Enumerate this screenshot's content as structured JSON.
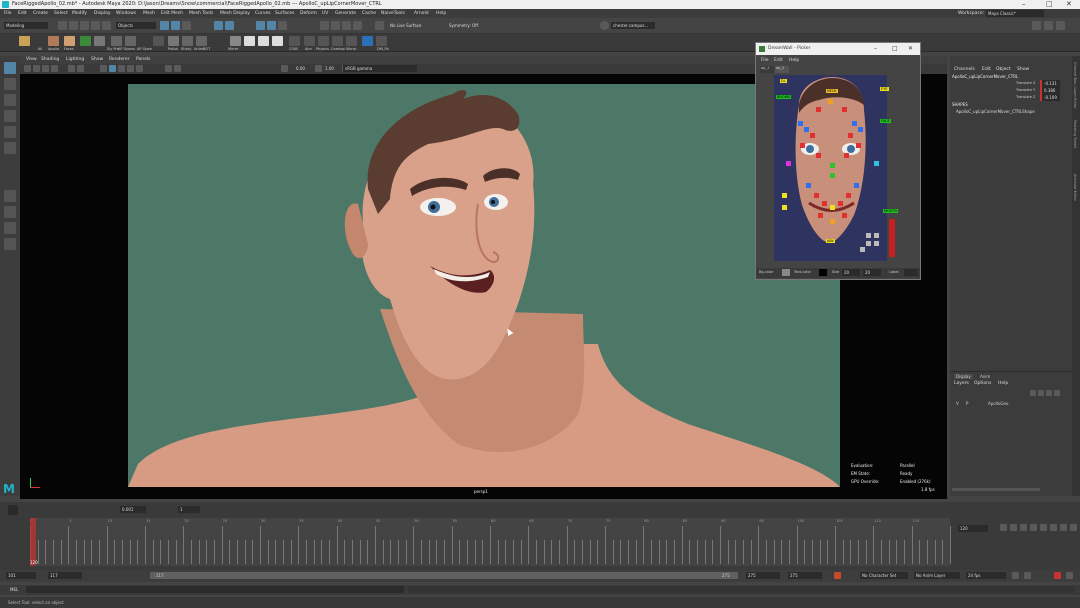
{
  "window": {
    "title": "FaceRiggedApollo_02.mb* - Autodesk Maya 2020: D:\\Jason\\Dreams\\Snow\\commercial\\FaceRiggedApollo_02.mb  ---  ApolloC_upLipCornerMover_CTRL",
    "controls": [
      "–",
      "□",
      "✕"
    ]
  },
  "menubar": {
    "items": [
      "File",
      "Edit",
      "Create",
      "Select",
      "Modify",
      "Display",
      "Windows",
      "Mesh",
      "Edit Mesh",
      "Mesh Tools",
      "Mesh Display",
      "Curves",
      "Surfaces",
      "Deform",
      "UV",
      "Generate",
      "Cache",
      "NaiveTools",
      "Arnold",
      "Help"
    ],
    "workspace_label": "Workspace:",
    "workspace_value": "Maya Classic*"
  },
  "statusline": {
    "mode": "Modeling",
    "objects_label": "Objects",
    "live_surface": "No Live Surface",
    "symmetry": "Symmetry: Off",
    "user": "chester.campos..."
  },
  "shelf": {
    "labels": [
      "All",
      "Apollo",
      "Faces",
      "",
      "Sly Pro",
      "AP Opens",
      "AP Open",
      "Polish",
      "Sticky",
      "AnimBOT",
      "",
      "Mirror",
      "",
      "",
      "",
      "",
      "",
      "COIB",
      "Aim",
      "Physics",
      "Overlap",
      "Mirror",
      "",
      "DM_Pk"
    ]
  },
  "viewport": {
    "menu": [
      "View",
      "Shading",
      "Lighting",
      "Show",
      "Renderer",
      "Panels"
    ],
    "field1": "0.00",
    "field2": "1.00",
    "color_space": "sRGB gamma",
    "camera_label": "persp1",
    "hud": [
      {
        "label": "Evaluation:",
        "value": "Parallel"
      },
      {
        "label": "EM State:",
        "value": "Ready"
      },
      {
        "label": "GPU Override:",
        "value": "Enabled (276k)"
      }
    ],
    "fps": "1.8 fps"
  },
  "picker": {
    "title": "DreamWall - Picker",
    "menu": [
      "File",
      "Edit",
      "Help"
    ],
    "tabs": [
      "ap_1",
      "ap_2"
    ],
    "tags": [
      "NECK",
      "DL",
      "EYE",
      "FACE",
      "BROWS",
      "MOUTH",
      "JAW"
    ],
    "footer": {
      "bg_label": "Bg-color",
      "text_label": "Text-color",
      "size_label": "Size",
      "size_w": "20",
      "size_h": "20",
      "label_label": "Label"
    }
  },
  "channelbox": {
    "menu": [
      "Channels",
      "Edit",
      "Object",
      "Show"
    ],
    "object": "ApolloC_upLipCornerMover_CTRL",
    "channels": [
      {
        "name": "Translate X",
        "value": "-0.131"
      },
      {
        "name": "Translate Y",
        "value": "0.386"
      },
      {
        "name": "Translate Z",
        "value": "-0.109"
      }
    ],
    "shapes_header": "SHAPES",
    "shape": "ApolloC_upLipCornerMover_CTRLShape",
    "side_tabs": [
      "Channel Box / Layer Editor",
      "Modeling Toolkit",
      "Attribute Editor"
    ]
  },
  "layers": {
    "tabs": [
      "Display",
      "Anim"
    ],
    "menu": [
      "Layers",
      "Options",
      "Help"
    ],
    "row": {
      "v": "V",
      "p": "P",
      "name": "ApolloGeo"
    }
  },
  "timeslider": {
    "tick_labels": [
      "0",
      "5",
      "10",
      "15",
      "20",
      "25",
      "30",
      "35",
      "40",
      "45",
      "50",
      "55",
      "60",
      "65",
      "70",
      "75",
      "80",
      "85",
      "90",
      "95",
      "100",
      "105",
      "110",
      "115"
    ],
    "current_frame": "120",
    "frame_field": "120",
    "step_field": "0.001",
    "cache_field": "1"
  },
  "rangebar": {
    "start": "101",
    "range_start": "117",
    "slider_start": "117",
    "slider_end": "275",
    "range_end": "275",
    "end": "275",
    "character_set": "No Character Set",
    "anim_layer": "No Anim Layer",
    "fps": "24 fps"
  },
  "mel": {
    "label": "MEL"
  },
  "help": {
    "text": "Select Tool: select an object"
  },
  "colors": {
    "viewport_bg": "#4d7766",
    "maya_dark": "#3a3a3a",
    "highlight": "#5285a6",
    "keyframe": "#c83232"
  }
}
